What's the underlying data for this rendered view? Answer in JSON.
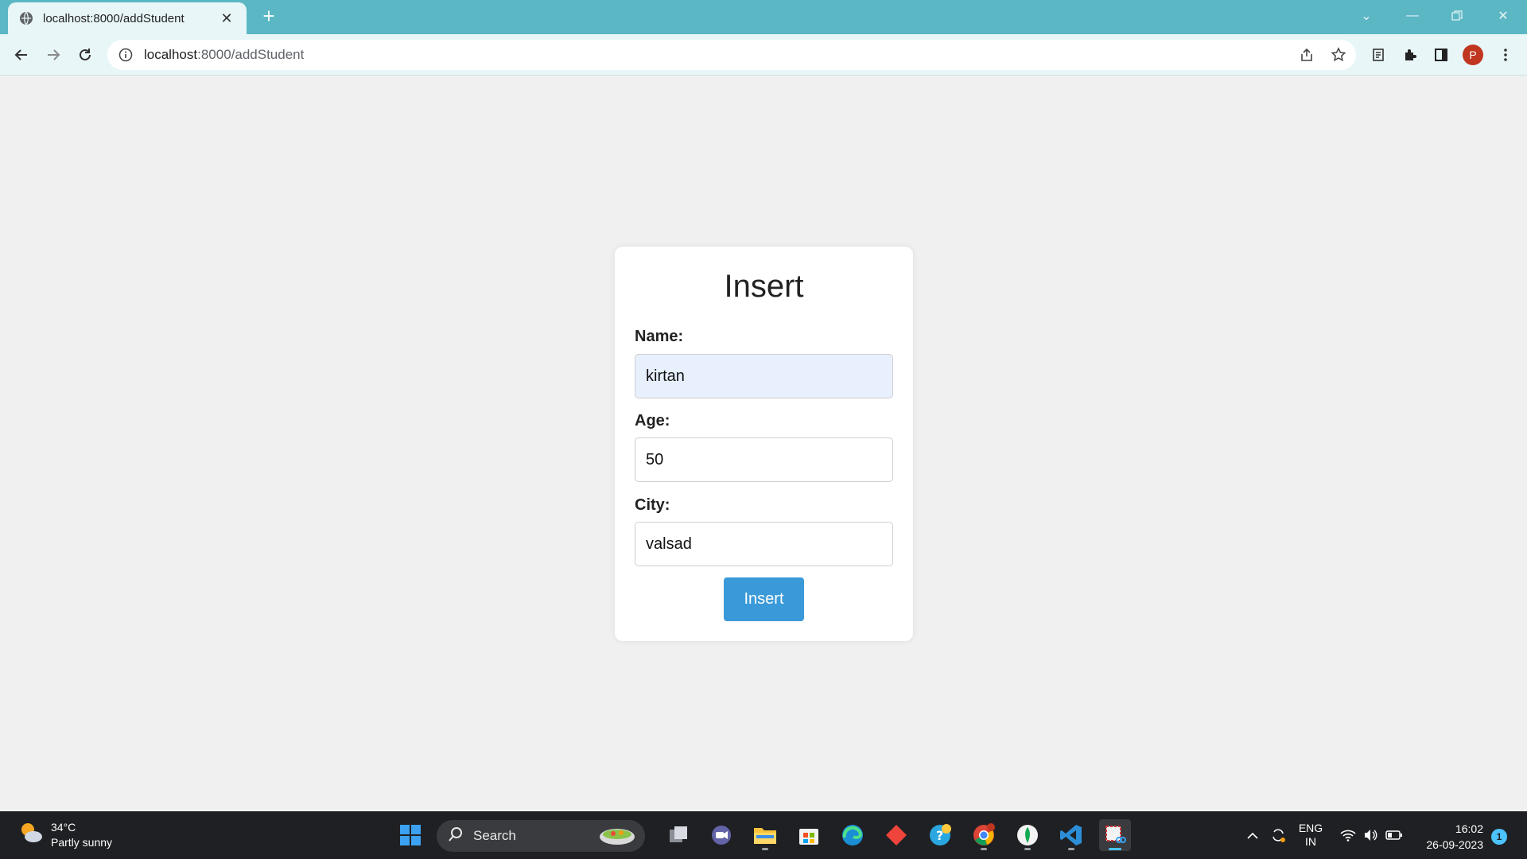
{
  "browser": {
    "tab_title": "localhost:8000/addStudent",
    "url_host": "localhost",
    "url_rest": ":8000/addStudent",
    "profile_initial": "P",
    "icons": [
      "globe-icon",
      "close-icon",
      "plus-icon",
      "back-icon",
      "forward-icon",
      "reload-icon",
      "info-icon",
      "share-icon",
      "star-icon",
      "reading-list-icon",
      "extensions-icon",
      "side-panel-icon",
      "menu-icon"
    ]
  },
  "form": {
    "heading": "Insert",
    "name_label": "Name:",
    "name_value": "kirtan",
    "age_label": "Age:",
    "age_value": "50",
    "city_label": "City:",
    "city_value": "valsad",
    "submit_label": "Insert",
    "accent_color": "#3a9ad9",
    "autofill_color": "#e8f0fe"
  },
  "taskbar": {
    "weather_temp": "34°C",
    "weather_desc": "Partly sunny",
    "search_placeholder": "Search",
    "language_top": "ENG",
    "language_bottom": "IN",
    "time": "16:02",
    "date": "26-09-2023",
    "notification_count": "1"
  }
}
